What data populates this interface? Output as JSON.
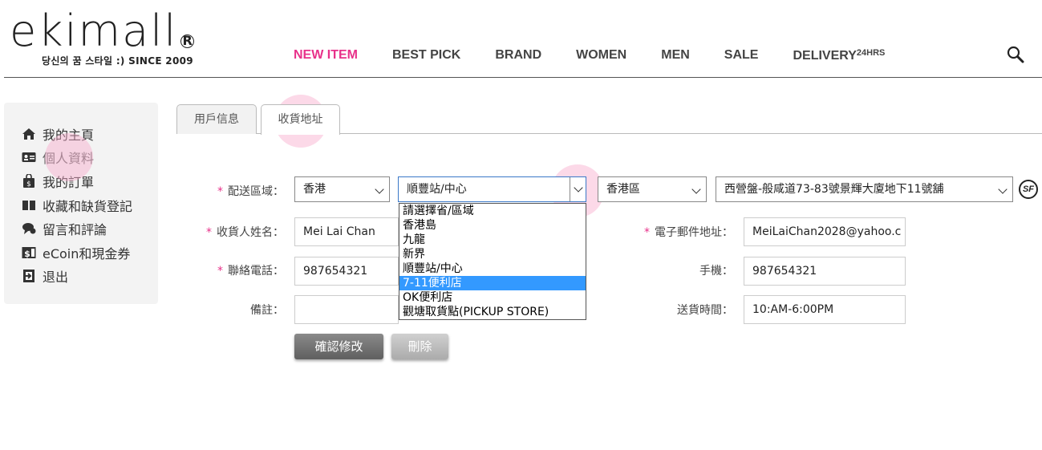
{
  "brand": {
    "logo_text": "ekimall",
    "registered": "R",
    "tagline": "당신의 꿈 스타일 :) SINCE 2009"
  },
  "nav": {
    "items": [
      "NEW ITEM",
      "BEST PICK",
      "BRAND",
      "WOMEN",
      "MEN",
      "SALE"
    ],
    "delivery_label": "DELIVERY",
    "delivery_sup": "24HRS",
    "active_color": "#e8318a"
  },
  "sidebar": {
    "items": [
      {
        "label": "我的主頁",
        "icon": "home-icon"
      },
      {
        "label": "個人資料",
        "icon": "id-card-icon"
      },
      {
        "label": "我的訂單",
        "icon": "shopping-bag-icon"
      },
      {
        "label": "收藏和缺貨登記",
        "icon": "book-icon"
      },
      {
        "label": "留言和評論",
        "icon": "chat-icon"
      },
      {
        "label": "eCoin和現金券",
        "icon": "coupon-icon"
      },
      {
        "label": "退出",
        "icon": "logout-icon"
      }
    ]
  },
  "tabs": {
    "user_info": "用戶信息",
    "shipping_address": "收貨地址"
  },
  "form": {
    "delivery_area_label": "配送區域：",
    "region_select": "香港",
    "method_select": "順豐站/中心",
    "district_select": "香港區",
    "station_select": "西營盤-般咸道73-83號景輝大廈地下11號舖",
    "method_options": [
      "請選擇省/區域",
      "香港島",
      "九龍",
      "新界",
      "順豐站/中心",
      "7-11便利店",
      "OK便利店",
      "觀塘取貨點(PICKUP STORE)"
    ],
    "method_highlighted_option": "7-11便利店",
    "recipient_label": "收貨人姓名：",
    "recipient_value": "Mei Lai Chan",
    "email_label": "電子郵件地址：",
    "email_value": "MeiLaiChan2028@yahoo.c",
    "phone_label": "聯絡電話：",
    "phone_value": "987654321",
    "mobile_label": "手機：",
    "mobile_value": "987654321",
    "remarks_label": "備註：",
    "remarks_value": "",
    "delivery_time_label": "送貨時間：",
    "delivery_time_value": "10:AM-6:00PM",
    "required_mark": "*",
    "sf_badge": "SF"
  },
  "buttons": {
    "confirm": "確認修改",
    "delete": "刪除"
  }
}
